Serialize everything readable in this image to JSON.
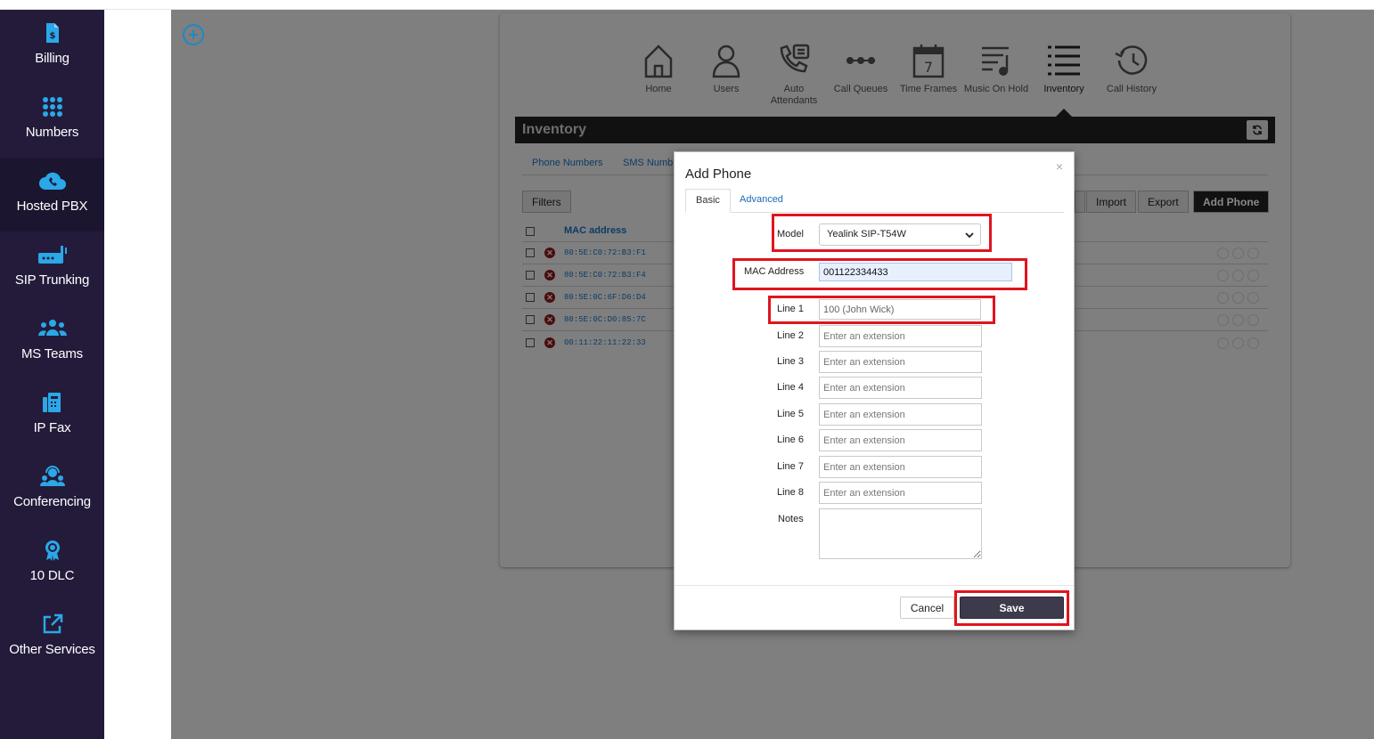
{
  "sidebar": {
    "items": [
      {
        "label": "Billing",
        "icon": "billing-icon"
      },
      {
        "label": "Numbers",
        "icon": "dialpad-icon"
      },
      {
        "label": "Hosted PBX",
        "icon": "cloud-phone-icon",
        "active": true
      },
      {
        "label": "SIP Trunking",
        "icon": "router-icon"
      },
      {
        "label": "MS Teams",
        "icon": "team-icon"
      },
      {
        "label": "IP Fax",
        "icon": "fax-icon"
      },
      {
        "label": "Conferencing",
        "icon": "conference-icon"
      },
      {
        "label": "10 DLC",
        "icon": "badge-icon"
      },
      {
        "label": "Other Services",
        "icon": "external-link-icon"
      }
    ]
  },
  "nav": {
    "items": [
      {
        "label": "Home",
        "icon": "home-icon"
      },
      {
        "label": "Users",
        "icon": "user-icon"
      },
      {
        "label": "Auto Attendants",
        "icon": "auto-attendant-icon"
      },
      {
        "label": "Call Queues",
        "icon": "call-queue-icon"
      },
      {
        "label": "Time Frames",
        "icon": "calendar-icon",
        "badge": "7"
      },
      {
        "label": "Music On Hold",
        "icon": "music-icon"
      },
      {
        "label": "Inventory",
        "icon": "list-icon",
        "active": true
      },
      {
        "label": "Call History",
        "icon": "history-icon"
      }
    ]
  },
  "inventory": {
    "title": "Inventory",
    "subtabs": [
      "Phone Numbers",
      "SMS Numb"
    ],
    "filters_label": "Filters",
    "import_label": "Import",
    "export_label": "Export",
    "add_phone_label": "Add Phone",
    "column_mac": "MAC address",
    "rows": [
      "80:5E:C0:72:B3:F1",
      "80:5E:C0:72:B3:F4",
      "80:5E:0C:6F:D6:D4",
      "80:5E:0C:D0:85:7C",
      "00:11:22:11:22:33"
    ]
  },
  "modal": {
    "title": "Add Phone",
    "close": "×",
    "tabs": {
      "basic": "Basic",
      "advanced": "Advanced"
    },
    "model_label": "Model",
    "model_value": "Yealink SIP-T54W",
    "mac_label": "MAC Address",
    "mac_value": "001122334433",
    "lines": [
      {
        "label": "Line 1",
        "value": "100 (John Wick)",
        "placeholder": ""
      },
      {
        "label": "Line 2",
        "value": "",
        "placeholder": "Enter an extension"
      },
      {
        "label": "Line 3",
        "value": "",
        "placeholder": "Enter an extension"
      },
      {
        "label": "Line 4",
        "value": "",
        "placeholder": "Enter an extension"
      },
      {
        "label": "Line 5",
        "value": "",
        "placeholder": "Enter an extension"
      },
      {
        "label": "Line 6",
        "value": "",
        "placeholder": "Enter an extension"
      },
      {
        "label": "Line 7",
        "value": "",
        "placeholder": "Enter an extension"
      },
      {
        "label": "Line 8",
        "value": "",
        "placeholder": "Enter an extension"
      }
    ],
    "notes_label": "Notes",
    "cancel_label": "Cancel",
    "save_label": "Save"
  },
  "colors": {
    "sidebar_bg": "#241b3b",
    "accent_blue": "#1e88c8",
    "highlight_red": "#e0141e",
    "save_bg": "#3d3a4b"
  }
}
